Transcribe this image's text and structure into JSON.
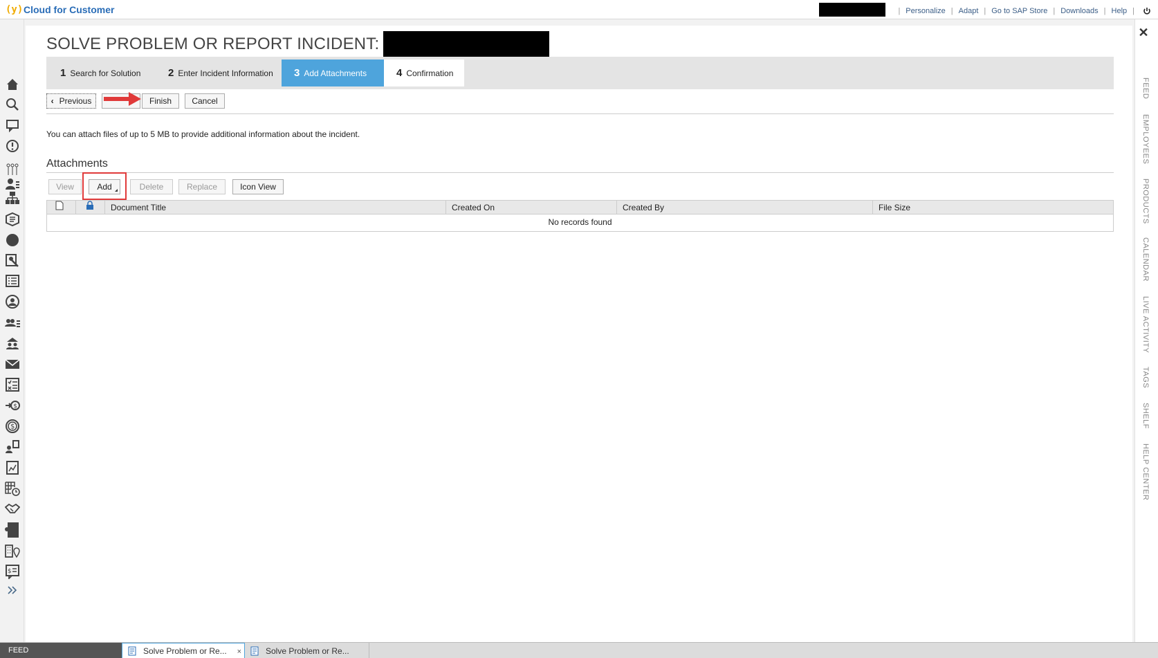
{
  "app": {
    "brand_logo": "(y)",
    "brand_name": "Cloud for Customer"
  },
  "topnav": {
    "links": [
      "Personalize",
      "Adapt",
      "Go to SAP Store",
      "Downloads",
      "Help"
    ],
    "separator": "|"
  },
  "page": {
    "title": "SOLVE PROBLEM OR REPORT INCIDENT:"
  },
  "steps": [
    {
      "num": "1",
      "label": "Search for Solution"
    },
    {
      "num": "2",
      "label": "Enter Incident Information"
    },
    {
      "num": "3",
      "label": "Add Attachments"
    },
    {
      "num": "4",
      "label": "Confirmation"
    }
  ],
  "buttons": {
    "previous_glyph": "‹",
    "previous": "Previous",
    "finish": "Finish",
    "cancel": "Cancel"
  },
  "info_text": "You can attach files of up to 5 MB to provide additional information about the incident.",
  "attachments": {
    "title": "Attachments",
    "toolbar": {
      "view": "View",
      "add": "Add",
      "delete": "Delete",
      "replace": "Replace",
      "icon_view": "Icon View"
    },
    "columns": [
      "Document Title",
      "Created On",
      "Created By",
      "File Size"
    ],
    "empty_text": "No records found"
  },
  "right_tabs": [
    "FEED",
    "EMPLOYEES",
    "PRODUCTS",
    "CALENDAR",
    "LIVE ACTIVITY",
    "TAGS",
    "SHELF",
    "HELP CENTER"
  ],
  "close_glyph": "✕",
  "bottom": {
    "feed": "FEED",
    "window_tabs": [
      "Solve Problem or Re...",
      "Solve Problem or Re..."
    ],
    "close_glyph": "×"
  },
  "colors": {
    "accent": "#4ea4dc",
    "brand": "#2a6db7",
    "highlight": "#e03a3a"
  },
  "left_nav_icons": [
    "home-icon",
    "search-icon",
    "chat-icon",
    "alert-icon",
    "hierarchy-icon",
    "org-chart-icon",
    "box-icon",
    "circle-icon",
    "tools-icon",
    "list-icon",
    "person-icon",
    "people-list-icon",
    "building-people-icon",
    "mail-icon",
    "checklist-icon",
    "transfer-dollar-icon",
    "dollar-icon",
    "person-doc-icon",
    "doc-chart-icon",
    "calendar-grid-icon",
    "handshake-icon",
    "user-folder-icon",
    "building-location-icon",
    "price-doc-icon",
    "expand-icon"
  ]
}
